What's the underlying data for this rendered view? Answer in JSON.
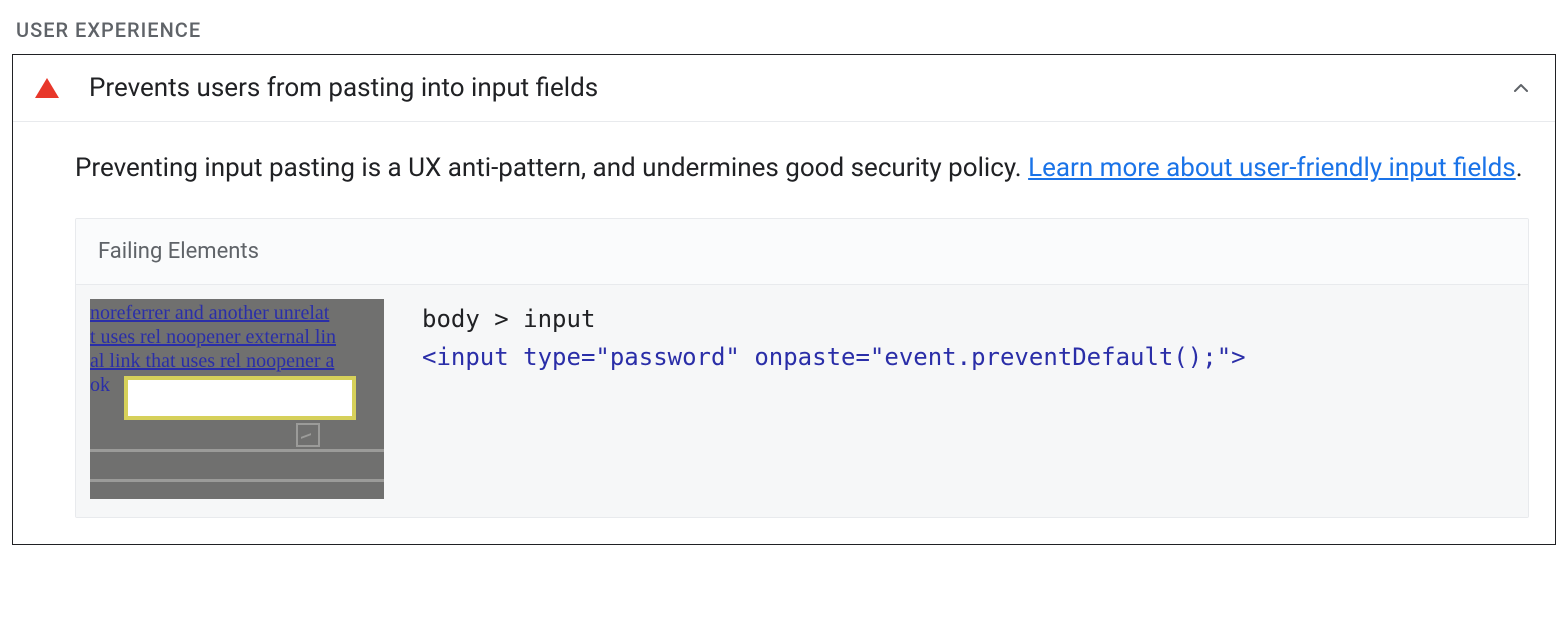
{
  "section_label": "USER EXPERIENCE",
  "audit": {
    "title": "Prevents users from pasting into input fields",
    "description_text": "Preventing input pasting is a UX anti-pattern, and undermines good security policy. ",
    "link_text": "Learn more about user-friendly input fields",
    "description_tail": ".",
    "failing_header": "Failing Elements",
    "thumb_lines": [
      "  noreferrer and another unrelat",
      "t uses rel noopener external lin",
      "al link that uses rel noopener a",
      "  ok"
    ],
    "selector": "body > input",
    "code": "<input type=\"password\" onpaste=\"event.preventDefault();\">"
  }
}
